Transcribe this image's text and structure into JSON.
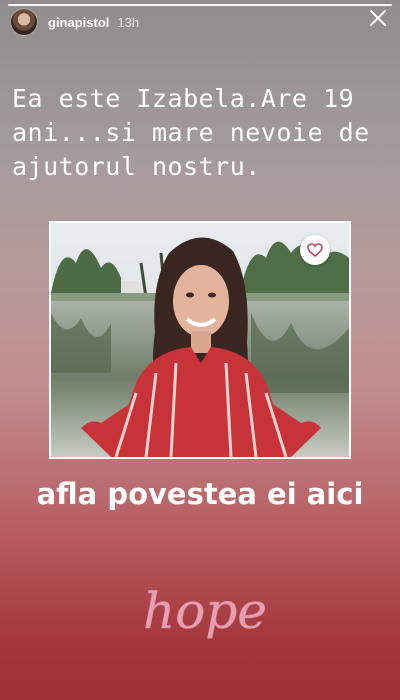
{
  "story": {
    "progress": 1.0,
    "username": "ginapistol",
    "time": "13h"
  },
  "content": {
    "headline": "Ea este Izabela.Are 19 ani...si mare nevoie de ajutorul nostru.",
    "cta": "afla povestea ei aici",
    "sticker_text": "hope"
  },
  "colors": {
    "gradient_top": "#8f8d8d",
    "gradient_bottom": "#9e2f35",
    "heart": "#c0445a",
    "sticker": "#e8a0b0"
  },
  "icons": {
    "close": "close-icon",
    "heart": "heart-icon"
  }
}
